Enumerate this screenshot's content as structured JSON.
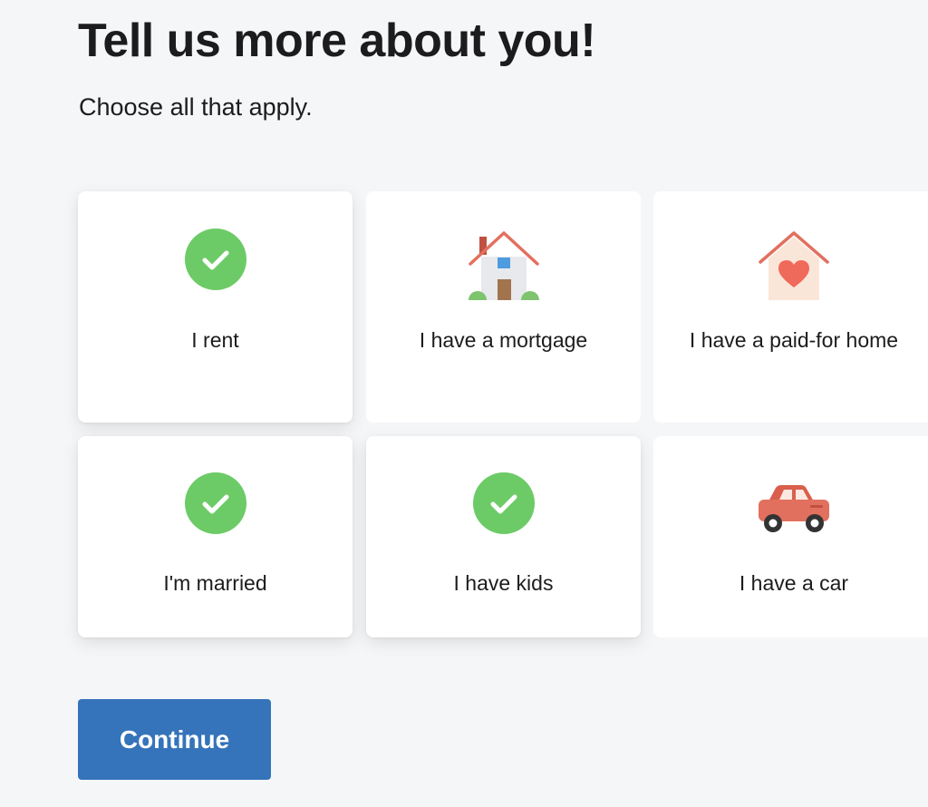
{
  "header": {
    "title": "Tell us more about you!",
    "subtitle": "Choose all that apply."
  },
  "options": [
    {
      "label": "I rent",
      "selected": true,
      "icon": "check-icon"
    },
    {
      "label": "I have a mortgage",
      "selected": false,
      "icon": "house-icon"
    },
    {
      "label": "I have a paid-for home",
      "selected": false,
      "icon": "heart-house-icon"
    },
    {
      "label": "I'm married",
      "selected": true,
      "icon": "check-icon"
    },
    {
      "label": "I have kids",
      "selected": true,
      "icon": "check-icon"
    },
    {
      "label": "I have a car",
      "selected": false,
      "icon": "car-icon"
    }
  ],
  "actions": {
    "continue_label": "Continue"
  },
  "colors": {
    "background": "#f5f6f8",
    "card": "#ffffff",
    "check_green": "#6ccb66",
    "primary_blue": "#3574ba",
    "coral": "#e2705f"
  }
}
